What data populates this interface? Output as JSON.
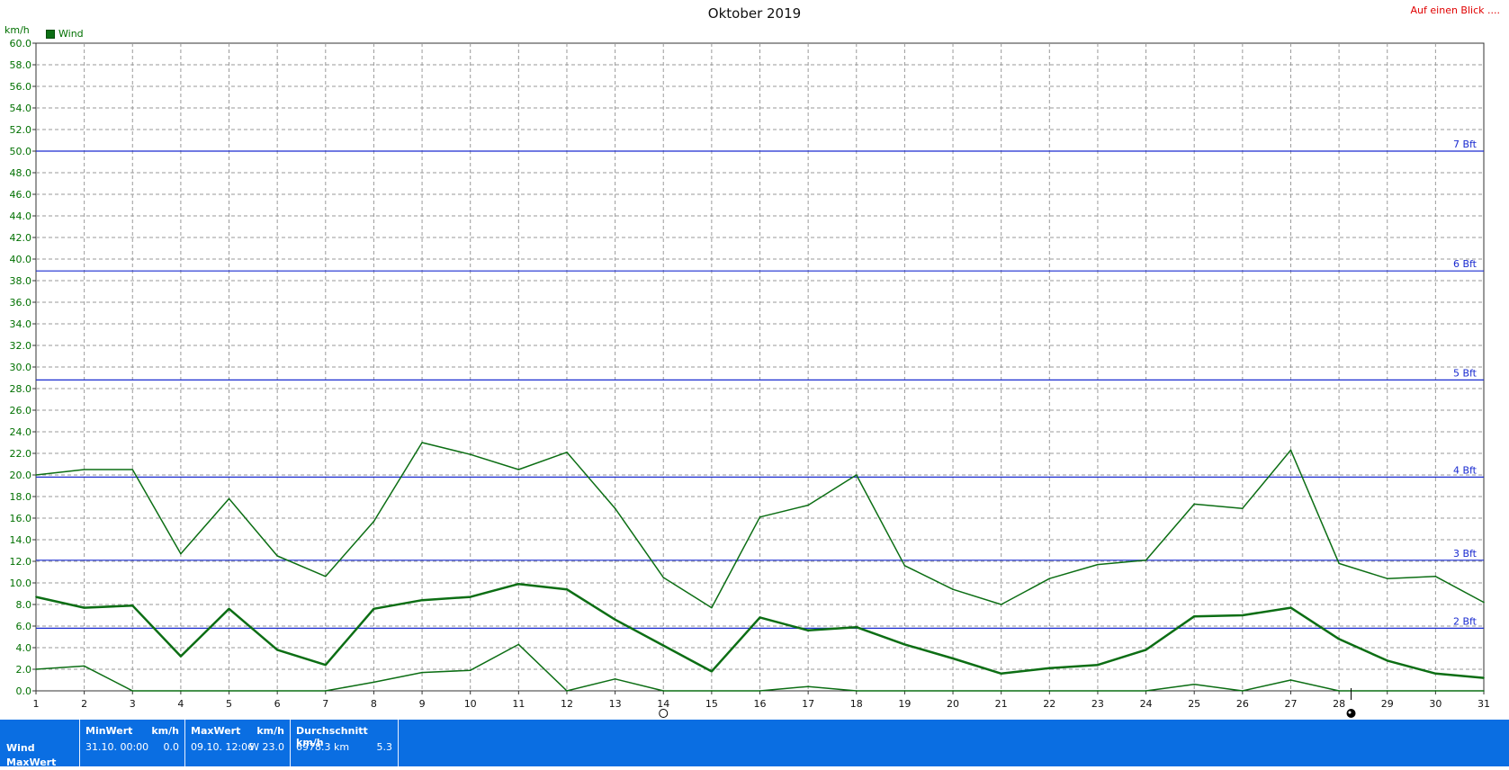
{
  "title": "Oktober 2019",
  "top_link": "Auf einen Blick ....",
  "y_unit": "km/h",
  "legend": {
    "label": "Wind",
    "color": "#0c6e14"
  },
  "colors": {
    "series": "#0c6e14",
    "reference": "#1a2bd0",
    "grid": "#9a9a9a",
    "axis": "#333333",
    "stats_bg": "#0a6ee2"
  },
  "chart_data": {
    "type": "line",
    "title": "Oktober 2019",
    "ylabel": "km/h",
    "xlim": [
      1,
      31
    ],
    "ylim": [
      0,
      60
    ],
    "y_ticks": [
      "0.0",
      "2.0",
      "4.0",
      "6.0",
      "8.0",
      "10.0",
      "12.0",
      "14.0",
      "16.0",
      "18.0",
      "20.0",
      "22.0",
      "24.0",
      "26.0",
      "28.0",
      "30.0",
      "32.0",
      "34.0",
      "36.0",
      "38.0",
      "40.0",
      "42.0",
      "44.0",
      "46.0",
      "48.0",
      "50.0",
      "52.0",
      "54.0",
      "56.0",
      "58.0",
      "60.0"
    ],
    "x": [
      1,
      2,
      3,
      4,
      5,
      6,
      7,
      8,
      9,
      10,
      11,
      12,
      13,
      14,
      15,
      16,
      17,
      18,
      19,
      20,
      21,
      22,
      23,
      24,
      25,
      26,
      27,
      28,
      29,
      30,
      31
    ],
    "series": [
      {
        "role": "max",
        "stroke": 1.5,
        "values": [
          20.0,
          20.5,
          20.5,
          12.7,
          17.8,
          12.5,
          10.6,
          15.7,
          23.0,
          21.9,
          20.5,
          22.1,
          16.9,
          10.5,
          7.7,
          16.1,
          17.2,
          20.0,
          11.6,
          9.4,
          8.0,
          10.4,
          11.7,
          12.1,
          17.3,
          16.9,
          22.3,
          11.8,
          10.4,
          10.6,
          8.2
        ]
      },
      {
        "role": "avg",
        "stroke": 2.5,
        "values": [
          8.7,
          7.7,
          7.9,
          3.2,
          7.6,
          3.8,
          2.4,
          7.6,
          8.4,
          8.7,
          9.9,
          9.4,
          6.6,
          4.2,
          1.8,
          6.8,
          5.6,
          5.9,
          4.3,
          3.0,
          1.6,
          2.1,
          2.4,
          3.8,
          6.9,
          7.0,
          7.7,
          4.8,
          2.8,
          1.6,
          1.2
        ]
      },
      {
        "role": "min",
        "stroke": 1.5,
        "values": [
          2.0,
          2.3,
          0.0,
          0.0,
          0.0,
          0.0,
          0.0,
          0.8,
          1.7,
          1.9,
          4.3,
          0.0,
          1.1,
          0.0,
          0.0,
          0.0,
          0.4,
          0.0,
          0.0,
          0.0,
          0.0,
          0.0,
          0.0,
          0.0,
          0.6,
          0.0,
          1.0,
          0.0,
          0.0,
          0.0,
          0.0
        ]
      }
    ],
    "reference_lines": [
      {
        "label": "7 Bft",
        "y": 50.0
      },
      {
        "label": "6 Bft",
        "y": 38.9
      },
      {
        "label": "5 Bft",
        "y": 28.8
      },
      {
        "label": "4 Bft",
        "y": 19.8
      },
      {
        "label": "3 Bft",
        "y": 12.1
      },
      {
        "label": "2 Bft",
        "y": 5.8
      }
    ],
    "grid": true,
    "legend_position": "top-left",
    "moon_phases": [
      {
        "day": 14,
        "phase": "full-moon"
      },
      {
        "day": 28.25,
        "phase": "new-moon"
      }
    ]
  },
  "stats": {
    "row_labels": [
      "Wind",
      "MaxWert"
    ],
    "min": {
      "header": "MinWert",
      "unit": "km/h",
      "date": "31.10.  00:00",
      "value": "0.0"
    },
    "max": {
      "header": "MaxWert",
      "unit": "km/h",
      "date": "09.10.  12:06",
      "value": "W 23.0"
    },
    "avg": {
      "header": "Durchschnitt km/h",
      "distance": "6978.3 km",
      "value": "5.3"
    }
  }
}
